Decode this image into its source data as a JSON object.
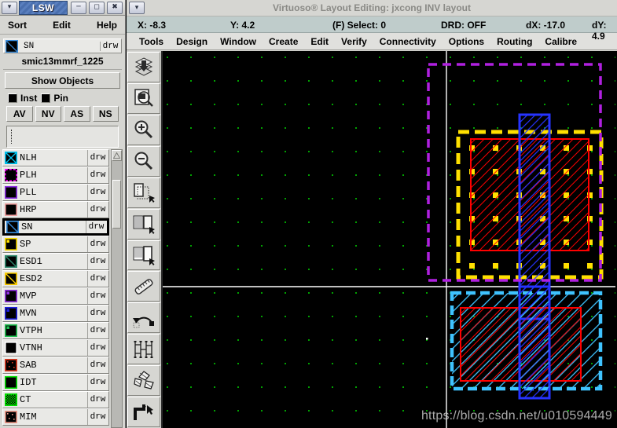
{
  "lsw": {
    "title": "LSW",
    "titlebar_buttons": [
      "chevron-down",
      "minimize",
      "maximize",
      "close"
    ],
    "menu": [
      "Sort",
      "Edit",
      "Help"
    ],
    "current_layer": {
      "name": "SN",
      "purpose": "drw"
    },
    "tech_name": "smic13mmrf_1225",
    "show_objects_label": "Show Objects",
    "checkboxes": [
      {
        "label": "Inst",
        "checked": true
      },
      {
        "label": "Pin",
        "checked": true
      }
    ],
    "visibility_buttons": [
      "AV",
      "NV",
      "AS",
      "NS"
    ],
    "filter_value": "",
    "layers": [
      {
        "name": "NLH",
        "purpose": "drw",
        "color": "#00c4f0",
        "fill": "cross",
        "selected": false
      },
      {
        "name": "PLH",
        "purpose": "drw",
        "color": "#ff00ff",
        "fill": "dashed",
        "selected": false
      },
      {
        "name": "PLL",
        "purpose": "drw",
        "color": "#8a2be2",
        "fill": "solidline",
        "selected": false
      },
      {
        "name": "HRP",
        "purpose": "drw",
        "color": "#f0a0a0",
        "fill": "solidline",
        "selected": false
      },
      {
        "name": "SN",
        "purpose": "drw",
        "color": "#3a8fe0",
        "fill": "diag",
        "selected": true
      },
      {
        "name": "SP",
        "purpose": "drw",
        "color": "#ffe000",
        "fill": "dot",
        "selected": false
      },
      {
        "name": "ESD1",
        "purpose": "drw",
        "color": "#2e8b6f",
        "fill": "diag",
        "selected": false
      },
      {
        "name": "ESD2",
        "purpose": "drw",
        "color": "#ffd000",
        "fill": "diag",
        "selected": false
      },
      {
        "name": "MVP",
        "purpose": "drw",
        "color": "#9030e0",
        "fill": "dot",
        "selected": false
      },
      {
        "name": "MVN",
        "purpose": "drw",
        "color": "#2020e0",
        "fill": "dot",
        "selected": false
      },
      {
        "name": "VTPH",
        "purpose": "drw",
        "color": "#20c050",
        "fill": "dot",
        "selected": false
      },
      {
        "name": "VTNH",
        "purpose": "drw",
        "color": "#ffffff",
        "fill": "solidline",
        "selected": false
      },
      {
        "name": "SAB",
        "purpose": "drw",
        "color": "#e03a20",
        "fill": "dots",
        "selected": false
      },
      {
        "name": "IDT",
        "purpose": "drw",
        "color": "#00e000",
        "fill": "solidline",
        "selected": false
      },
      {
        "name": "CT",
        "purpose": "drw",
        "color": "#00e000",
        "fill": "checker",
        "selected": false
      },
      {
        "name": "MIM",
        "purpose": "drw",
        "color": "#f09a8a",
        "fill": "dots",
        "selected": false
      }
    ]
  },
  "main": {
    "title": "Virtuoso® Layout Editing: jxcong INV layout",
    "status": [
      {
        "key": "X:",
        "value": "-8.3"
      },
      {
        "key": "Y:",
        "value": "4.2"
      },
      {
        "key": "(F) Select:",
        "value": "0"
      },
      {
        "key": "DRD:",
        "value": "OFF"
      },
      {
        "key": "dX:",
        "value": "-17.0"
      },
      {
        "key": "dY:",
        "value": "4.9"
      }
    ],
    "menu": [
      "Tools",
      "Design",
      "Window",
      "Create",
      "Edit",
      "Verify",
      "Connectivity",
      "Options",
      "Routing",
      "Calibre"
    ],
    "tools": [
      "save-to-library-icon",
      "find-zoom-icon",
      "zoom-in-icon",
      "zoom-out-icon",
      "stretch-icon",
      "copy-icon",
      "move-icon",
      "ruler-icon",
      "undo-icon",
      "instance-icon",
      "chop-icon",
      "path-icon"
    ],
    "canvas": {
      "grid_color": "#00a000",
      "axis_color": "#ffffff",
      "background": "#000000",
      "shapes": [
        {
          "name": "prboundary",
          "layer": "PLL",
          "color": "#b020e0",
          "style": "dashed"
        },
        {
          "name": "nwell",
          "layer": "SP",
          "color": "#ffe000",
          "style": "dashed-dot"
        },
        {
          "name": "pdiff",
          "layer": "HRP",
          "color": "#ff0000",
          "style": "diag-red"
        },
        {
          "name": "poly",
          "layer": "PLH",
          "color": "#2020ff",
          "style": "diag-blue"
        },
        {
          "name": "ndiff",
          "layer": "NLH",
          "color": "#40c0ff",
          "style": "diag-cyan"
        }
      ]
    },
    "watermark": "https://blog.csdn.net/u010594449"
  }
}
